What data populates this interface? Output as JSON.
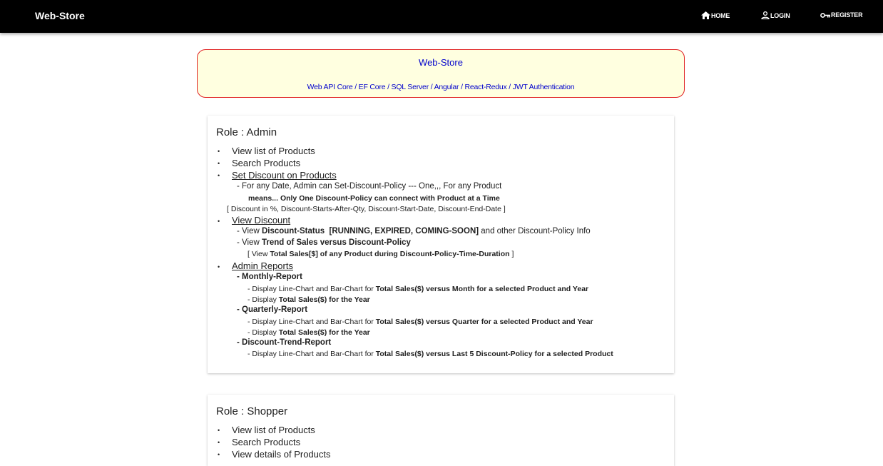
{
  "nav": {
    "brand": "Web-Store",
    "home": "HOME",
    "login": "LOGIN",
    "register": "REGISTER"
  },
  "banner": {
    "title": "Web-Store",
    "subtitle": "Web API Core / EF Core / SQL Server / Angular / React-Redux / JWT Authentication"
  },
  "admin": {
    "title": "Role : Admin",
    "item1": "View list of Products",
    "item2": "Search Products",
    "item3": "Set Discount on Products",
    "policy_line": "- For any Date, Admin can Set-Discount-Policy --- One,,, For any Product",
    "policy_means": "means... Only One Discount-Policy can connect with Product at a Time",
    "policy_fields": "[ Discount in %, Discount-Starts-After-Qty, Discount-Start-Date, Discount-End-Date ]",
    "item4": "View Discount",
    "vd1_pre": "- View ",
    "vd1_bold1": "Discount-Status",
    "vd1_bold2": "[RUNNING, EXPIRED, COMING-SOON]",
    "vd1_post": " and other Discount-Policy Info",
    "vd2_pre": "- View ",
    "vd2_bold": "Trend of Sales versus Discount-Policy",
    "vd3_pre": "[ View ",
    "vd3_bold": "Total Sales[$] of any Product during Discount-Policy-Time-Duration",
    "vd3_post": " ]",
    "item5": "Admin Reports",
    "monthly": "- Monthly-Report",
    "monthly_l1_pre": "- Display Line-Chart and Bar-Chart for ",
    "monthly_l1_bold": "Total Sales($) versus Month for a selected Product and Year",
    "monthly_l2_pre": "- Display ",
    "monthly_l2_bold": "Total Sales($) for the Year",
    "quarterly": "- Quarterly-Report",
    "quarterly_l1_pre": "- Display Line-Chart and Bar-Chart for ",
    "quarterly_l1_bold": "Total Sales($) versus Quarter for a selected Product and Year",
    "quarterly_l2_pre": "- Display ",
    "quarterly_l2_bold": "Total Sales($) for the Year",
    "trend": "- Discount-Trend-Report",
    "trend_l1_pre": "- Display Line-Chart and Bar-Chart for ",
    "trend_l1_bold": "Total Sales($) versus Last 5 Discount-Policy for a selected Product"
  },
  "shopper": {
    "title": "Role : Shopper",
    "item1": "View list of Products",
    "item2": "Search Products",
    "item3": "View details of Products"
  },
  "colors": {
    "topbar": "#000000",
    "banner_bg": "#ffffe0",
    "banner_border": "#e02020",
    "banner_text": "#0000cc"
  }
}
